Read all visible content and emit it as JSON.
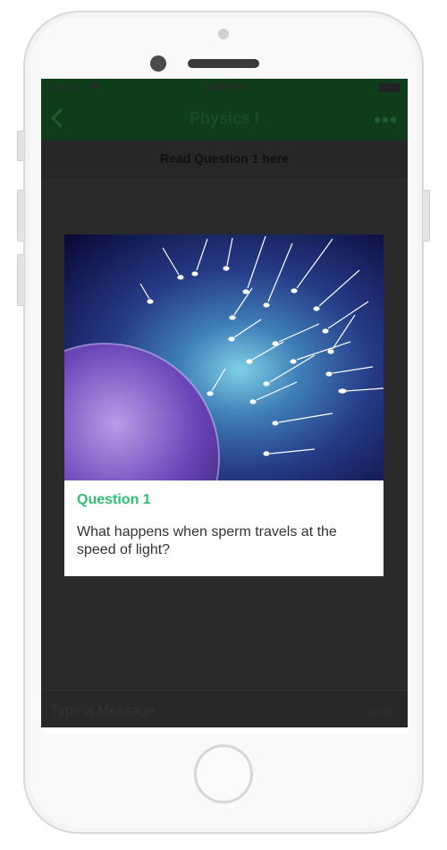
{
  "status_bar": {
    "carrier": "Carrier",
    "time": "4:48 PM",
    "wifi_icon": "wifi-icon",
    "battery_icon": "battery-icon"
  },
  "navbar": {
    "title": "Physics I",
    "back_icon": "chevron-left-icon",
    "more_icon": "ellipsis-icon"
  },
  "question_header": {
    "text": "Read Question 1 here"
  },
  "card": {
    "image": "sperm-cells-swimming-toward-egg",
    "label": "Question 1",
    "text": "What happens when sperm travels at the speed of light?"
  },
  "composer": {
    "placeholder": "Type a Message",
    "send_label": "Send"
  },
  "colors": {
    "nav_green": "#0f3d1c",
    "accent_green": "#2fbf71",
    "overlay": "#2a2a2a"
  }
}
